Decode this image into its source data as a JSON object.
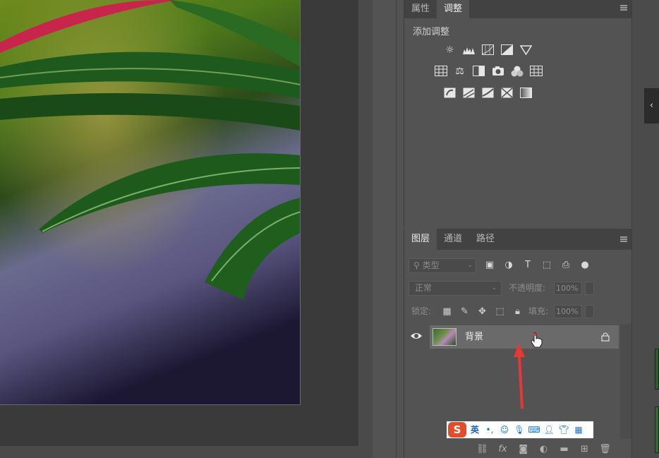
{
  "adjust_panel": {
    "tabs": [
      {
        "label": "属性"
      },
      {
        "label": "调整"
      }
    ],
    "title": "添加调整",
    "rows": [
      [
        "brightness-contrast-icon",
        "levels-icon",
        "curves-icon",
        "exposure-icon",
        "vibrance-icon"
      ],
      [
        "hue-saturation-icon",
        "color-balance-icon",
        "black-white-icon",
        "photo-filter-icon",
        "channel-mixer-icon",
        "color-lookup-icon"
      ],
      [
        "invert-icon",
        "posterize-icon",
        "threshold-icon",
        "selective-color-icon",
        "gradient-map-icon"
      ]
    ]
  },
  "layers_panel": {
    "tabs": [
      {
        "label": "图层"
      },
      {
        "label": "通道"
      },
      {
        "label": "路径"
      }
    ],
    "filter_placeholder": "类型",
    "blend_mode": "正常",
    "opacity_label": "不透明度:",
    "opacity_value": "100%",
    "lock_label": "锁定:",
    "fill_label": "填充:",
    "fill_value": "100%",
    "layers": [
      {
        "name": "背景"
      }
    ]
  },
  "ime_toolbar": {
    "logo": "S",
    "mode": "英"
  },
  "colors": {
    "panel_bg": "#535353",
    "tab_bar": "#424242",
    "selected_layer": "#6a6a6a",
    "annotation_arrow": "#e53935"
  }
}
